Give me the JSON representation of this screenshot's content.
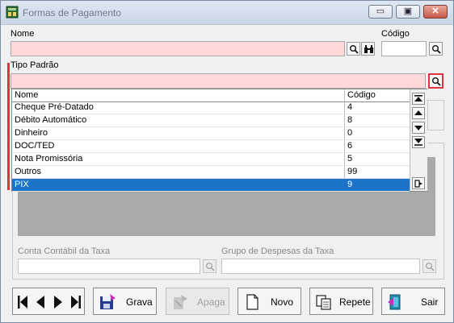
{
  "window": {
    "title": "Formas de Pagamento",
    "controls": {
      "minimize": "▭",
      "restore": "▣",
      "close": "✕"
    }
  },
  "form": {
    "nome_label": "Nome",
    "nome_value": "",
    "codigo_label": "Código",
    "codigo_value": "",
    "tipo_padrao_label": "Tipo Padrão",
    "tipo_padrao_value": "",
    "conta_taxa_label": "Conta Contábil da Taxa",
    "grupo_despesas_label": "Grupo de Despesas da Taxa"
  },
  "dropdown": {
    "columns": [
      "Nome",
      "Código"
    ],
    "rows": [
      {
        "nome": "Cheque Pré-Datado",
        "codigo": "4"
      },
      {
        "nome": "Débito Automático",
        "codigo": "8"
      },
      {
        "nome": "Dinheiro",
        "codigo": "0"
      },
      {
        "nome": "DOC/TED",
        "codigo": "6"
      },
      {
        "nome": "Nota Promissória",
        "codigo": "5"
      },
      {
        "nome": "Outros",
        "codigo": "99"
      },
      {
        "nome": "PIX",
        "codigo": "9"
      }
    ],
    "selected_index": 6
  },
  "actions": {
    "grava": "Grava",
    "apaga": "Apaga",
    "novo": "Novo",
    "repete": "Repete",
    "sair": "Sair"
  },
  "colors": {
    "required_field": "#ffd9d9",
    "selection": "#1c73c8",
    "required_marker": "#e0343d"
  }
}
